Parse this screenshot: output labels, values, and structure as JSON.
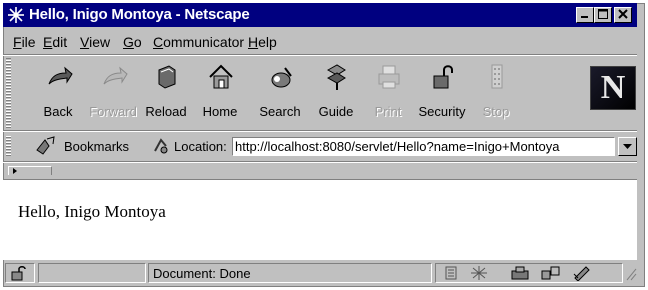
{
  "window": {
    "title": "Hello, Inigo Montoya - Netscape",
    "icons": {
      "app": "netscape-app-icon",
      "minimize": "minimize-icon",
      "maximize": "maximize-icon",
      "close": "close-icon"
    }
  },
  "menubar": {
    "items": [
      {
        "first": "F",
        "rest": "ile"
      },
      {
        "first": "E",
        "rest": "dit"
      },
      {
        "first": "V",
        "rest": "iew"
      },
      {
        "first": "G",
        "rest": "o"
      },
      {
        "first": "C",
        "rest": "ommunicator"
      },
      {
        "first": "H",
        "rest": "elp"
      }
    ]
  },
  "toolbar": {
    "buttons": [
      {
        "label": "Back",
        "icon": "back-icon",
        "enabled": true
      },
      {
        "label": "Forward",
        "icon": "forward-icon",
        "enabled": false
      },
      {
        "label": "Reload",
        "icon": "reload-icon",
        "enabled": true
      },
      {
        "label": "Home",
        "icon": "home-icon",
        "enabled": true
      },
      {
        "label": "Search",
        "icon": "search-icon",
        "enabled": true
      },
      {
        "label": "Guide",
        "icon": "guide-icon",
        "enabled": true
      },
      {
        "label": "Print",
        "icon": "print-icon",
        "enabled": false
      },
      {
        "label": "Security",
        "icon": "security-icon",
        "enabled": true
      },
      {
        "label": "Stop",
        "icon": "stop-icon",
        "enabled": false
      }
    ],
    "logo": "N"
  },
  "location": {
    "bookmarks_label": "Bookmarks",
    "location_label": "Location:",
    "url": "http://localhost:8080/servlet/Hello?name=Inigo+Montoya"
  },
  "content": {
    "text": "Hello, Inigo Montoya"
  },
  "status": {
    "text": "Document: Done"
  },
  "colors": {
    "titlebar": "#000080",
    "chrome": "#c0c0c0",
    "page": "#ffffff"
  }
}
